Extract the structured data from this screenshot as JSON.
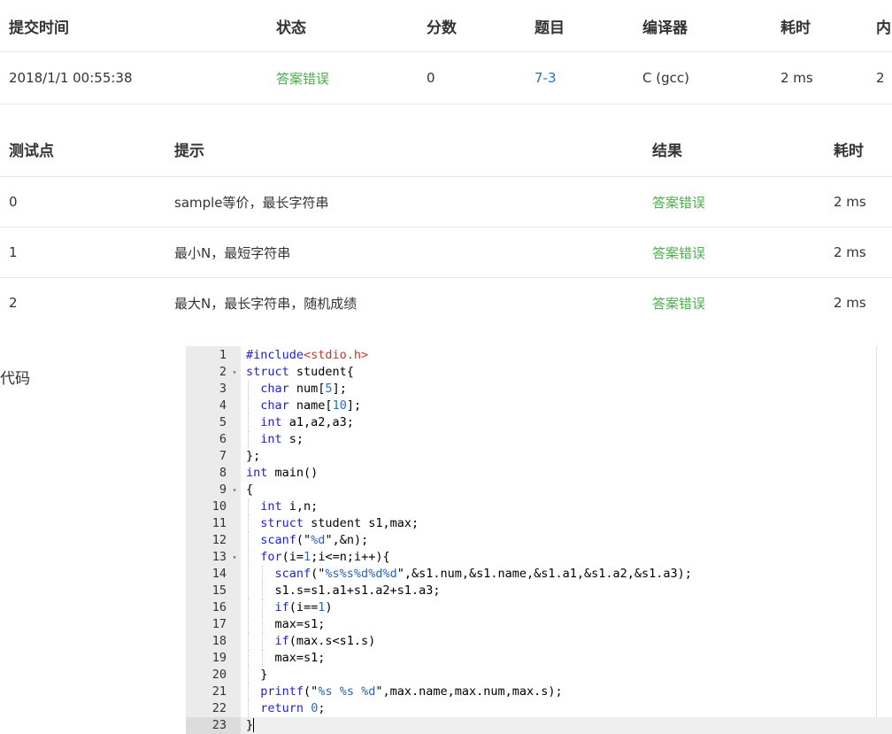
{
  "submission": {
    "headers": [
      "提交时间",
      "状态",
      "分数",
      "题目",
      "编译器",
      "耗时",
      "内"
    ],
    "row": {
      "time": "2018/1/1 00:55:38",
      "status": "答案错误",
      "score": "0",
      "problem": "7-3",
      "compiler": "C (gcc)",
      "duration": "2 ms",
      "memory": "2"
    }
  },
  "testcases": {
    "headers": [
      "测试点",
      "提示",
      "结果",
      "耗时"
    ],
    "rows": [
      {
        "id": "0",
        "hint": "sample等价，最长字符串",
        "result": "答案错误",
        "time": "2 ms"
      },
      {
        "id": "1",
        "hint": "最小N，最短字符串",
        "result": "答案错误",
        "time": "2 ms"
      },
      {
        "id": "2",
        "hint": "最大N，最长字符串，随机成绩",
        "result": "答案错误",
        "time": "2 ms"
      }
    ]
  },
  "code": {
    "label": "代码",
    "lines": [
      {
        "n": "1",
        "fold": false,
        "text": "#include<stdio.h>"
      },
      {
        "n": "2",
        "fold": true,
        "text": "struct student{"
      },
      {
        "n": "3",
        "fold": false,
        "text": "  char num[5];"
      },
      {
        "n": "4",
        "fold": false,
        "text": "  char name[10];"
      },
      {
        "n": "5",
        "fold": false,
        "text": "  int a1,a2,a3;"
      },
      {
        "n": "6",
        "fold": false,
        "text": "  int s;"
      },
      {
        "n": "7",
        "fold": false,
        "text": "};"
      },
      {
        "n": "8",
        "fold": false,
        "text": "int main()"
      },
      {
        "n": "9",
        "fold": true,
        "text": "{"
      },
      {
        "n": "10",
        "fold": false,
        "text": "  int i,n;"
      },
      {
        "n": "11",
        "fold": false,
        "text": "  struct student s1,max;"
      },
      {
        "n": "12",
        "fold": false,
        "text": "  scanf(\"%d\",&n);"
      },
      {
        "n": "13",
        "fold": true,
        "text": "  for(i=1;i<=n;i++){"
      },
      {
        "n": "14",
        "fold": false,
        "text": "    scanf(\"%s%s%d%d%d\",&s1.num,&s1.name,&s1.a1,&s1.a2,&s1.a3);"
      },
      {
        "n": "15",
        "fold": false,
        "text": "    s1.s=s1.a1+s1.a2+s1.a3;"
      },
      {
        "n": "16",
        "fold": false,
        "text": "    if(i==1)"
      },
      {
        "n": "17",
        "fold": false,
        "text": "    max=s1;"
      },
      {
        "n": "18",
        "fold": false,
        "text": "    if(max.s<s1.s)"
      },
      {
        "n": "19",
        "fold": false,
        "text": "    max=s1;"
      },
      {
        "n": "20",
        "fold": false,
        "text": "  }"
      },
      {
        "n": "21",
        "fold": false,
        "text": "  printf(\"%s %s %d\",max.name,max.num,max.s);"
      },
      {
        "n": "22",
        "fold": false,
        "text": "  return 0;"
      },
      {
        "n": "23",
        "fold": false,
        "text": "}"
      }
    ],
    "active_line": "23"
  },
  "colors": {
    "status_error": "#4cae4c",
    "link": "#2a6ebb",
    "keyword": "#2222cc",
    "string": "#2a62b5",
    "include": "#c0392b",
    "gutter": "#ebebeb"
  }
}
